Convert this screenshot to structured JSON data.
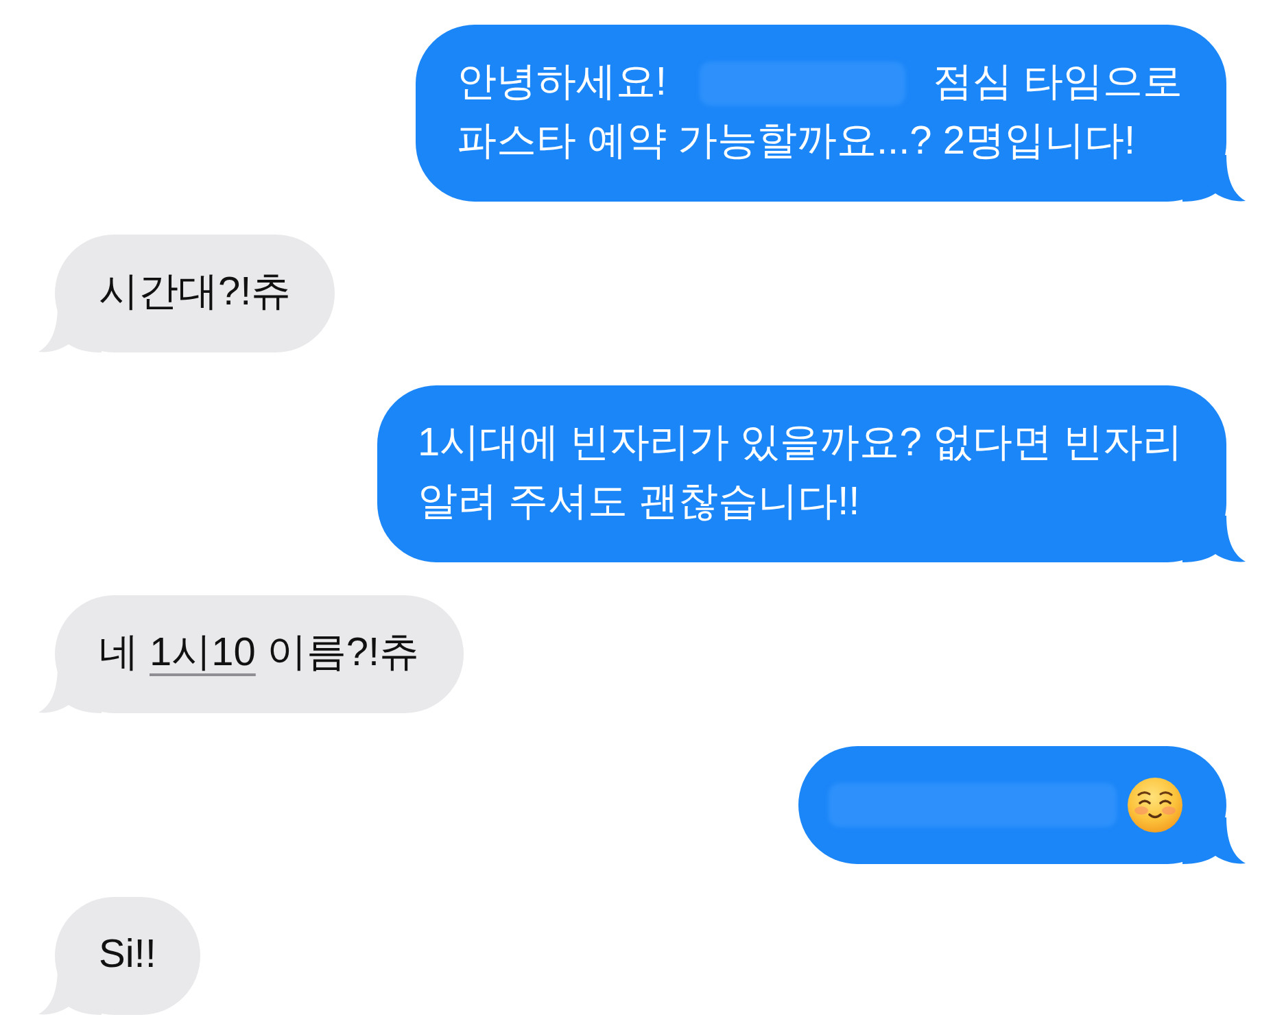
{
  "messages": [
    {
      "kind": "sent",
      "lines": [
        [
          {
            "kind": "text",
            "text": "안녕하세요!"
          },
          {
            "kind": "redacted"
          },
          {
            "kind": "text",
            "text": "점심 타임으로"
          }
        ],
        [
          {
            "kind": "text",
            "text": "파스타 예약 가능할까요...? 2명입니다!"
          }
        ]
      ]
    },
    {
      "kind": "received",
      "lines": [
        [
          {
            "kind": "text",
            "text": "시간대?!츄"
          }
        ]
      ]
    },
    {
      "kind": "sent",
      "lines": [
        [
          {
            "kind": "text",
            "text": "1시대에 빈자리가 있을까요? 없다면 빈자리"
          }
        ],
        [
          {
            "kind": "text",
            "text": "알려 주셔도 괜찮습니다!!"
          }
        ]
      ]
    },
    {
      "kind": "received",
      "lines": [
        [
          {
            "kind": "text",
            "text": "네"
          },
          {
            "kind": "link",
            "text": "1시10"
          },
          {
            "kind": "text",
            "text": "이름?!츄"
          }
        ]
      ]
    },
    {
      "kind": "sent",
      "lines": [
        [
          {
            "kind": "redacted"
          },
          {
            "kind": "emoji"
          }
        ]
      ]
    },
    {
      "kind": "received",
      "lines": [
        [
          {
            "kind": "text",
            "text": "Si!!"
          }
        ]
      ]
    }
  ]
}
